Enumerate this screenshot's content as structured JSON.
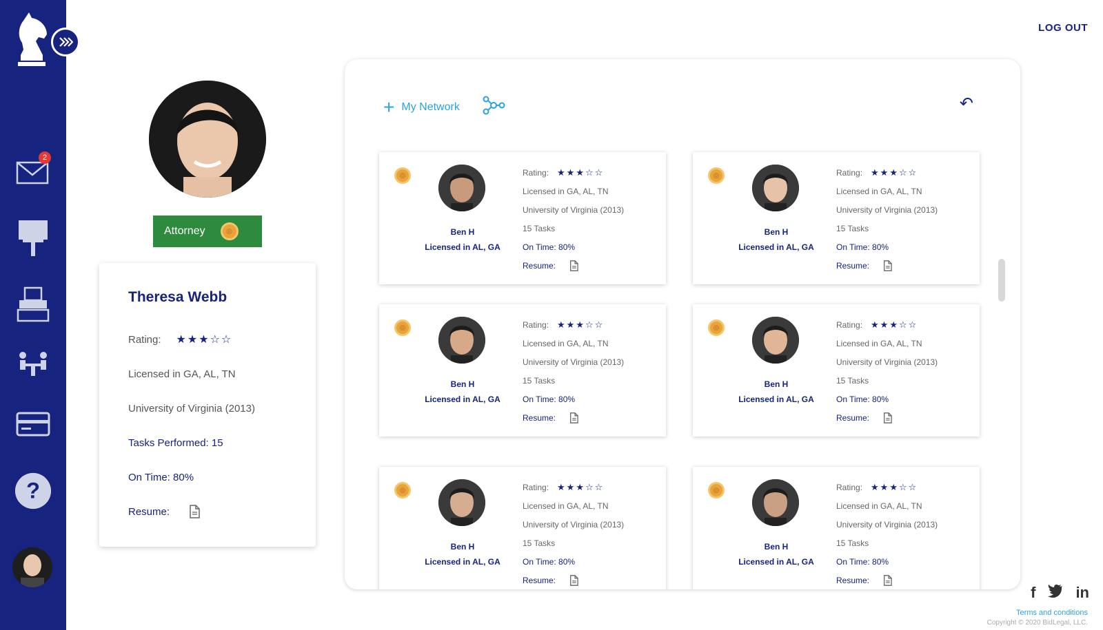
{
  "header": {
    "logout_label": "LOG OUT"
  },
  "sidebar": {
    "items": [
      {
        "name": "mail-icon",
        "badge": "2"
      },
      {
        "name": "bid-icon",
        "label": "BID"
      },
      {
        "name": "typewriter-icon"
      },
      {
        "name": "meeting-icon"
      },
      {
        "name": "payment-card-icon"
      },
      {
        "name": "help-icon",
        "label": "?"
      }
    ]
  },
  "profile": {
    "role_label": "Attorney",
    "name": "Theresa Webb",
    "rating_label": "Rating:",
    "rating": 3,
    "rating_max": 5,
    "licensed": "Licensed in GA, AL, TN",
    "education": "University of Virginia (2013)",
    "tasks": "Tasks Performed: 15",
    "on_time": "On Time: 80%",
    "resume_label": "Resume:"
  },
  "network": {
    "title": "My Network",
    "cards": [
      {
        "name": "Ben H",
        "licensed_short": "Licensed in AL, GA",
        "rating_label": "Rating:",
        "rating": 3,
        "licensed": "Licensed in GA, AL, TN",
        "education": "University of Virginia (2013)",
        "tasks": "15 Tasks",
        "on_time": "On Time: 80%",
        "resume_label": "Resume:"
      },
      {
        "name": "Ben H",
        "licensed_short": "Licensed in AL, GA",
        "rating_label": "Rating:",
        "rating": 3,
        "licensed": "Licensed in GA, AL, TN",
        "education": "University of Virginia (2013)",
        "tasks": "15 Tasks",
        "on_time": "On Time: 80%",
        "resume_label": "Resume:"
      },
      {
        "name": "Ben H",
        "licensed_short": "Licensed in AL, GA",
        "rating_label": "Rating:",
        "rating": 3,
        "licensed": "Licensed in GA, AL, TN",
        "education": "University of Virginia (2013)",
        "tasks": "15 Tasks",
        "on_time": "On Time: 80%",
        "resume_label": "Resume:"
      },
      {
        "name": "Ben H",
        "licensed_short": "Licensed in AL, GA",
        "rating_label": "Rating:",
        "rating": 3,
        "licensed": "Licensed in GA, AL, TN",
        "education": "University of Virginia (2013)",
        "tasks": "15 Tasks",
        "on_time": "On Time: 80%",
        "resume_label": "Resume:"
      },
      {
        "name": "Ben H",
        "licensed_short": "Licensed in AL, GA",
        "rating_label": "Rating:",
        "rating": 3,
        "licensed": "Licensed in GA, AL, TN",
        "education": "University of Virginia (2013)",
        "tasks": "15 Tasks",
        "on_time": "On Time: 80%",
        "resume_label": "Resume:"
      },
      {
        "name": "Ben H",
        "licensed_short": "Licensed in AL, GA",
        "rating_label": "Rating:",
        "rating": 3,
        "licensed": "Licensed in GA, AL, TN",
        "education": "University of Virginia (2013)",
        "tasks": "15 Tasks",
        "on_time": "On Time: 80%",
        "resume_label": "Resume:"
      }
    ]
  },
  "footer": {
    "social": [
      "f",
      "t",
      "in"
    ],
    "terms": "Terms and conditions",
    "copyright": "Copyright © 2020 BidLegal, LLC."
  },
  "colors": {
    "navy": "#16237f",
    "green": "#2e8b3e",
    "sky": "#29a3e0",
    "gold": "#e8a33a"
  }
}
